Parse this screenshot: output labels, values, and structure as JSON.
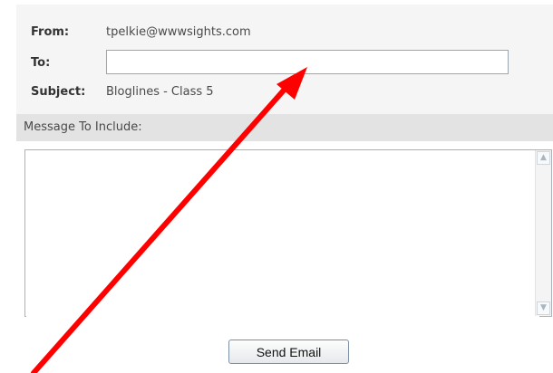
{
  "form": {
    "from_label": "From:",
    "from_value": "tpelkie@wwwsights.com",
    "to_label": "To:",
    "to_value": "",
    "subject_label": "Subject:",
    "subject_value": "Bloglines - Class 5"
  },
  "message": {
    "header_label": "Message To Include:",
    "body_value": ""
  },
  "actions": {
    "send_label": "Send Email"
  },
  "colors": {
    "annotation_arrow": "#ff0000",
    "panel_bg": "#f5f5f5",
    "header_bg": "#e3e3e3"
  },
  "annotation": {
    "type": "arrow",
    "points_to": "to-input"
  }
}
